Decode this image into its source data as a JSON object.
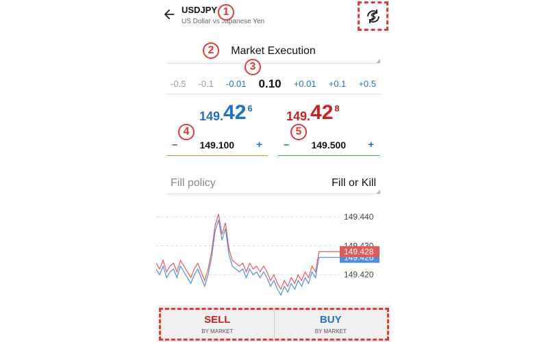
{
  "header": {
    "symbol": "USDJPY",
    "description": "US Dollar vs Japanese Yen",
    "back_icon": "arrow-left-icon",
    "sync_icon": "sync-dollar-icon"
  },
  "annotations": [
    "1",
    "2",
    "3",
    "4",
    "5"
  ],
  "execution": {
    "label": "Market Execution"
  },
  "volume": {
    "steps": [
      "-0.5",
      "-0.1",
      "-0.01",
      "0.10",
      "+0.01",
      "+0.1",
      "+0.5"
    ],
    "current": "0.10"
  },
  "prices": {
    "bid": {
      "small": "149.",
      "big": "42",
      "sup": "6",
      "color": "#1e70cf"
    },
    "ask": {
      "small": "149.",
      "big": "42",
      "sup": "8",
      "color": "#cc1f1f"
    }
  },
  "stop_loss": {
    "value": "149.100",
    "minus": "–",
    "plus": "+"
  },
  "take_profit": {
    "value": "149.500",
    "minus": "–",
    "plus": "+"
  },
  "fill_policy": {
    "label": "Fill policy",
    "value": "Fill or Kill"
  },
  "chart_data": {
    "type": "line",
    "y_ticks": [
      "149.440",
      "149.430",
      "149.420"
    ],
    "current_ask_label": "149.428",
    "current_bid_label": "149.426",
    "ylim": [
      149.41,
      149.445
    ],
    "series": [
      {
        "values": [
          149.424,
          149.422,
          149.425,
          149.421,
          149.423,
          149.424,
          149.421,
          149.425,
          149.423,
          149.421,
          149.419,
          149.422,
          149.424,
          149.421,
          149.418,
          149.422,
          149.428,
          149.437,
          149.441,
          149.434,
          149.438,
          149.429,
          149.425,
          149.424,
          149.423,
          149.424,
          149.421,
          149.424,
          149.422,
          149.423,
          149.421,
          149.423,
          149.421,
          149.418,
          149.42,
          149.417,
          149.415,
          149.418,
          149.416,
          149.419,
          149.417,
          149.42,
          149.418,
          149.421,
          149.419,
          149.423,
          149.421,
          149.428,
          149.428,
          149.428,
          149.428,
          149.428,
          149.428,
          149.428
        ],
        "color": "#e05a5a"
      },
      {
        "values": [
          149.422,
          149.42,
          149.423,
          149.419,
          149.421,
          149.422,
          149.419,
          149.423,
          149.421,
          149.419,
          149.417,
          149.42,
          149.422,
          149.419,
          149.416,
          149.42,
          149.426,
          149.435,
          149.439,
          149.432,
          149.436,
          149.427,
          149.423,
          149.422,
          149.421,
          149.422,
          149.419,
          149.422,
          149.42,
          149.421,
          149.419,
          149.421,
          149.419,
          149.416,
          149.418,
          149.415,
          149.413,
          149.416,
          149.414,
          149.417,
          149.415,
          149.418,
          149.416,
          149.419,
          149.417,
          149.421,
          149.419,
          149.426,
          149.426,
          149.426,
          149.426,
          149.426,
          149.426,
          149.426
        ],
        "color": "#4a8fe0"
      }
    ]
  },
  "trade": {
    "sell_label": "SELL",
    "sell_sub": "BY MARKET",
    "sell_color": "#cc1f1f",
    "buy_label": "BUY",
    "buy_sub": "BY MARKET",
    "buy_color": "#1e70cf"
  }
}
